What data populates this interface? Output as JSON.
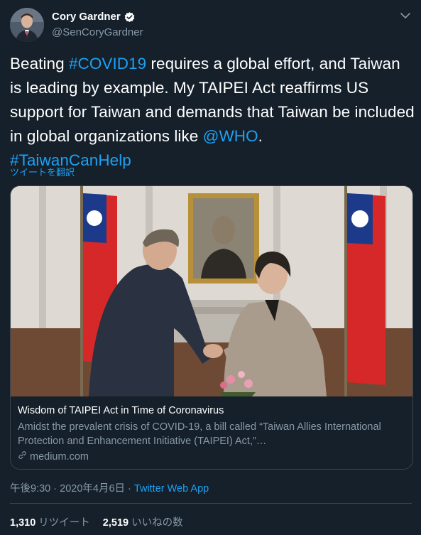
{
  "author": {
    "display_name": "Cory Gardner",
    "handle": "@SenCoryGardner"
  },
  "tweet": {
    "text_1": "Beating ",
    "hashtag_covid": "#COVID19",
    "text_2": " requires a global effort, and Taiwan is leading by example. My TAIPEI Act reaffirms US support for Taiwan and demands that Taiwan be included in global organizations like ",
    "mention_who": "@WHO",
    "text_3": ".",
    "hashtag_taiwan": "#TaiwanCanHelp",
    "translate_label": "ツイートを翻訳"
  },
  "card": {
    "title": "Wisdom of TAIPEI Act in Time of Coronavirus",
    "description": "Amidst the prevalent crisis of COVID-19, a bill called “Taiwan Allies International Protection and Enhancement Initiative (TAIPEI) Act,”…",
    "domain": "medium.com"
  },
  "meta": {
    "time": "午後9:30",
    "separator": " · ",
    "date": "2020年4月6日",
    "separator2": " · ",
    "app": "Twitter Web App"
  },
  "stats": {
    "retweets_count": "1,310",
    "retweets_label": "リツイート",
    "likes_count": "2,519",
    "likes_label": "いいねの数"
  },
  "colors": {
    "background": "#15202b",
    "link": "#1da1f2",
    "secondary": "#8899a6",
    "border": "#38444d"
  },
  "icons": [
    "verified-badge-icon",
    "chevron-down-icon",
    "link-icon"
  ]
}
